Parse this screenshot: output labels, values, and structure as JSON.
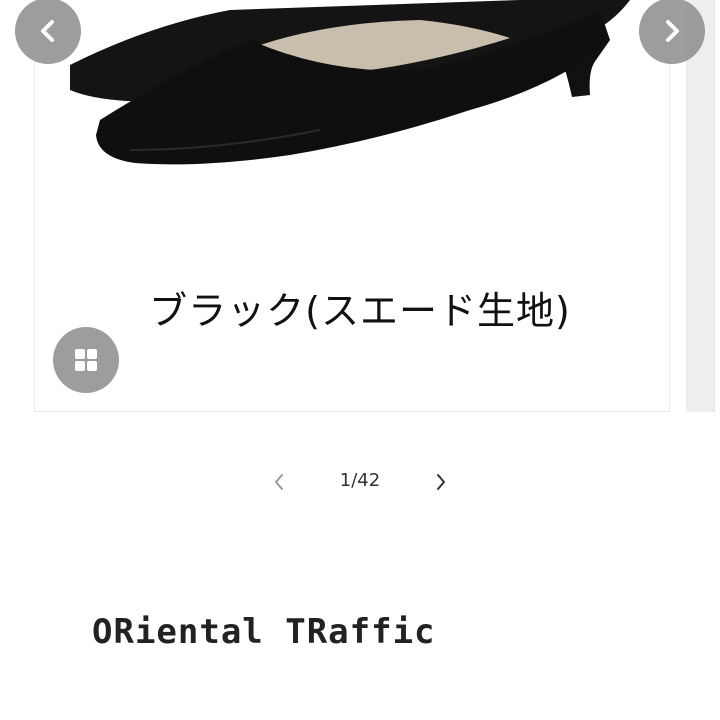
{
  "gallery": {
    "caption": "ブラック(スエード生地)",
    "prev_icon": "chevron-left-icon",
    "next_icon": "chevron-right-icon",
    "grid_icon": "grid-icon"
  },
  "pager": {
    "counter": "1/42",
    "prev_icon": "chevron-left-icon",
    "next_icon": "chevron-right-icon"
  },
  "brand": {
    "name": "ORiental TRaffic"
  },
  "colors": {
    "button_bg": "#8c8c8c",
    "shoe": "#111111",
    "shoe_lining": "#c9beab"
  }
}
